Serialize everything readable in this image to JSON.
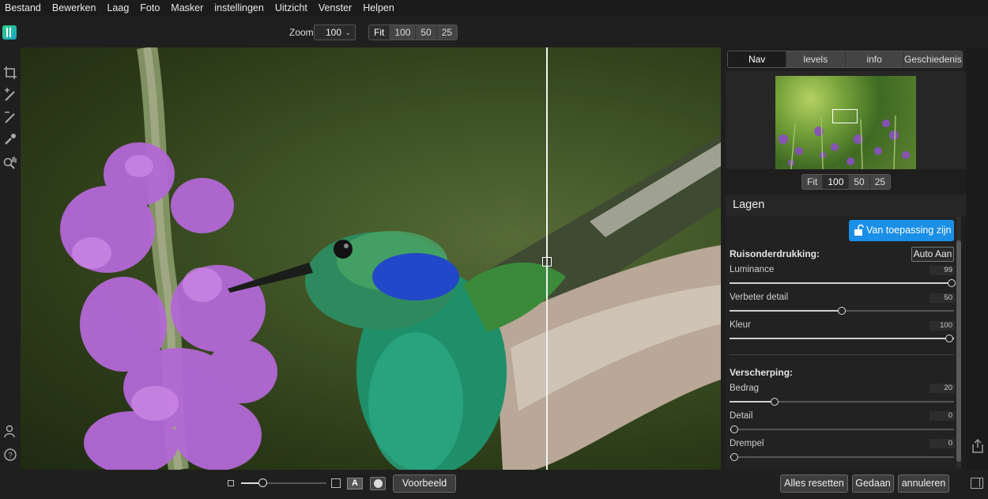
{
  "menu": [
    "Bestand",
    "Bewerken",
    "Laag",
    "Foto",
    "Masker",
    "instellingen",
    "Uitzicht",
    "Venster",
    "Helpen"
  ],
  "toolbar": {
    "zoom_label": "Zoom",
    "zoom_value": "100",
    "zoom_presets": [
      "Fit",
      "100",
      "50",
      "25"
    ]
  },
  "panel": {
    "tabs": [
      "Nav",
      "levels",
      "info",
      "Geschiedenis"
    ],
    "active_tab": "Nav",
    "nav_zoom_presets": [
      "Fit",
      "100",
      "50",
      "25"
    ],
    "layers_title": "Lagen",
    "apply_label": "Van toepassing zijn",
    "noise": {
      "title": "Ruisonderdrukking:",
      "auto_label": "Auto Aan",
      "luminance_label": "Luminance",
      "luminance_value": "99",
      "detail_label": "Verbeter detail",
      "detail_value": "50",
      "color_label": "Kleur",
      "color_value": "100"
    },
    "sharpen": {
      "title": "Verscherping:",
      "amount_label": "Bedrag",
      "amount_value": "20",
      "detail_label": "Detail",
      "detail_value": "0",
      "threshold_label": "Drempel",
      "threshold_value": "0"
    }
  },
  "bottom": {
    "preview_label": "Voorbeeld",
    "reset_label": "Alles resetten",
    "done_label": "Gedaan",
    "cancel_label": "annuleren",
    "a_label": "A"
  },
  "accent_color": "#1a8fe8"
}
